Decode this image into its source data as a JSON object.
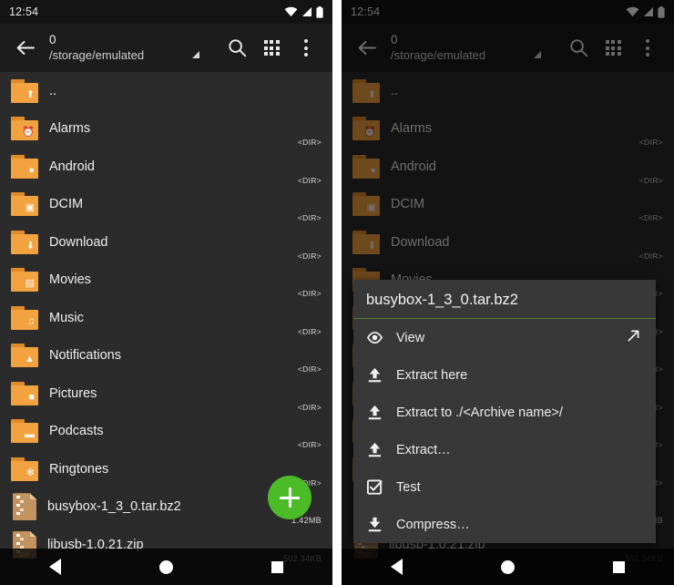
{
  "status": {
    "time": "12:54",
    "icons": [
      "wifi-icon",
      "signal-icon",
      "battery-icon"
    ]
  },
  "toolbar": {
    "back_label": "back-arrow",
    "path_top": "0",
    "path_sub": "/storage/emulated",
    "search_label": "search-icon",
    "grid_label": "grid-view-icon",
    "overflow_label": "overflow-menu-icon"
  },
  "list": {
    "items": [
      {
        "name": "..",
        "meta": "",
        "icon": "folder-up-icon",
        "type": "folder",
        "glyph": "⬆"
      },
      {
        "name": "Alarms",
        "meta": "<DIR>",
        "icon": "folder-alarms-icon",
        "type": "folder",
        "glyph": "⏰"
      },
      {
        "name": "Android",
        "meta": "<DIR>",
        "icon": "folder-android-icon",
        "type": "folder",
        "glyph": "●"
      },
      {
        "name": "DCIM",
        "meta": "<DIR>",
        "icon": "folder-camera-icon",
        "type": "folder",
        "glyph": "▣"
      },
      {
        "name": "Download",
        "meta": "<DIR>",
        "icon": "folder-download-icon",
        "type": "folder",
        "glyph": "⬇"
      },
      {
        "name": "Movies",
        "meta": "<DIR>",
        "icon": "folder-movies-icon",
        "type": "folder",
        "glyph": "▤"
      },
      {
        "name": "Music",
        "meta": "<DIR>",
        "icon": "folder-music-icon",
        "type": "folder",
        "glyph": "♫"
      },
      {
        "name": "Notifications",
        "meta": "<DIR>",
        "icon": "folder-notifications-icon",
        "type": "folder",
        "glyph": "▲"
      },
      {
        "name": "Pictures",
        "meta": "<DIR>",
        "icon": "folder-pictures-icon",
        "type": "folder",
        "glyph": "■"
      },
      {
        "name": "Podcasts",
        "meta": "<DIR>",
        "icon": "folder-podcasts-icon",
        "type": "folder",
        "glyph": "▬"
      },
      {
        "name": "Ringtones",
        "meta": "<DIR>",
        "icon": "folder-ringtones-icon",
        "type": "folder",
        "glyph": "✻"
      },
      {
        "name": "busybox-1_3_0.tar.bz2",
        "meta": "1.42MB",
        "icon": "archive-file-icon",
        "type": "archive",
        "badge": ""
      },
      {
        "name": "libusb-1.0.21.zip",
        "meta": "502.34KB",
        "icon": "zip-file-icon",
        "type": "archive",
        "badge": "ZIP"
      }
    ]
  },
  "fab": {
    "label": "add-button",
    "glyph": "+",
    "color": "#4cbb28"
  },
  "navbar": {
    "back": "nav-back",
    "home": "nav-home",
    "recents": "nav-recents"
  },
  "dialog": {
    "title": "busybox-1_3_0.tar.bz2",
    "divider_color": "#5b7a33",
    "items": [
      {
        "label": "View",
        "icon": "eye-icon",
        "trailing": "open-external-icon"
      },
      {
        "label": "Extract here",
        "icon": "extract-up-icon",
        "trailing": ""
      },
      {
        "label": "Extract to ./<Archive name>/",
        "icon": "extract-up-icon",
        "trailing": ""
      },
      {
        "label": "Extract…",
        "icon": "extract-up-icon",
        "trailing": ""
      },
      {
        "label": "Test",
        "icon": "check-box-icon",
        "trailing": ""
      },
      {
        "label": "Compress…",
        "icon": "compress-down-icon",
        "trailing": ""
      }
    ]
  }
}
